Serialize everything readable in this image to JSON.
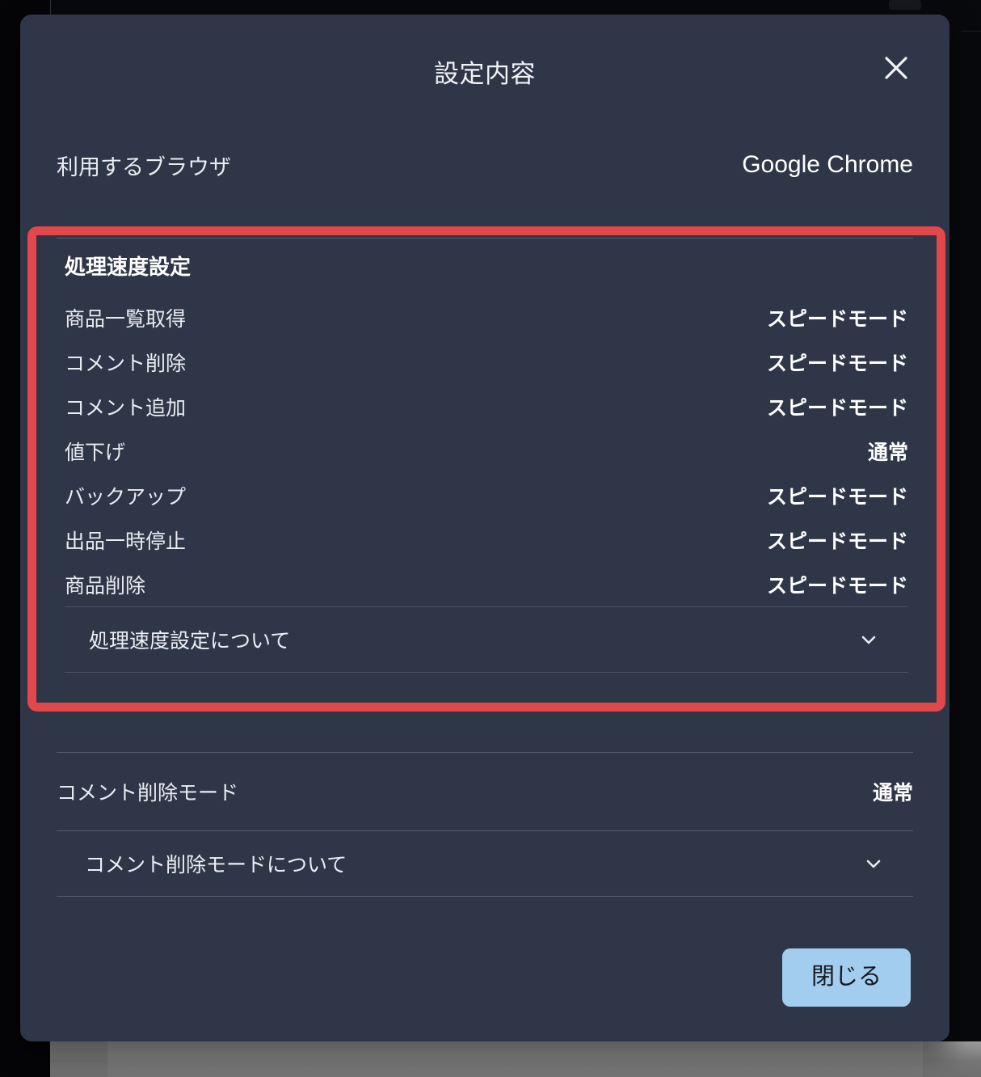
{
  "modal": {
    "title": "設定内容",
    "close_icon": "close-x-icon",
    "browser": {
      "label": "利用するブラウザ",
      "value": "Google Chrome"
    },
    "speed_section": {
      "heading": "処理速度設定",
      "highlight_color": "#e2474a",
      "rows": [
        {
          "label": "商品一覧取得",
          "value": "スピードモード"
        },
        {
          "label": "コメント削除",
          "value": "スピードモード"
        },
        {
          "label": "コメント追加",
          "value": "スピードモード"
        },
        {
          "label": "値下げ",
          "value": "通常"
        },
        {
          "label": "バックアップ",
          "value": "スピードモード"
        },
        {
          "label": "出品一時停止",
          "value": "スピードモード"
        },
        {
          "label": "商品削除",
          "value": "スピードモード"
        }
      ],
      "accordion": {
        "label": "処理速度設定について",
        "icon": "chevron-down-icon"
      }
    },
    "comment_delete_mode": {
      "label": "コメント削除モード",
      "value": "通常",
      "accordion": {
        "label": "コメント削除モードについて",
        "icon": "chevron-down-icon"
      }
    },
    "footer": {
      "close_label": "閉じる",
      "close_button_color": "#a2cdee"
    }
  }
}
